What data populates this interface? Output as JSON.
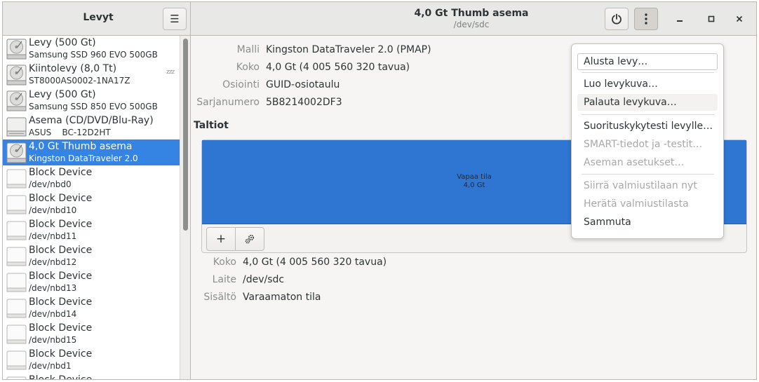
{
  "sidebar": {
    "title": "Levyt",
    "devices": [
      {
        "name": "Levy (500 Gt)",
        "sub": "Samsung SSD 960 EVO 500GB",
        "icon": "hard-disk-icon"
      },
      {
        "name": "Kiintolevy (8,0 Tt)",
        "sub": "ST8000AS0002-1NA17Z",
        "icon": "hard-disk-icon",
        "badge": "zzz"
      },
      {
        "name": "Levy (500 Gt)",
        "sub": "Samsung SSD 850 EVO 500GB",
        "icon": "hard-disk-icon"
      },
      {
        "name": "Asema (CD/DVD/Blu-Ray)",
        "sub": "ASUS    BC-12D2HT",
        "icon": "optical-drive-icon"
      },
      {
        "name": "4,0 Gt Thumb asema",
        "sub": "Kingston DataTraveler 2.0",
        "icon": "hard-disk-icon",
        "selected": true
      },
      {
        "name": "Block Device",
        "sub": "/dev/nbd0",
        "icon": "block-device-icon"
      },
      {
        "name": "Block Device",
        "sub": "/dev/nbd10",
        "icon": "block-device-icon"
      },
      {
        "name": "Block Device",
        "sub": "/dev/nbd11",
        "icon": "block-device-icon"
      },
      {
        "name": "Block Device",
        "sub": "/dev/nbd12",
        "icon": "block-device-icon"
      },
      {
        "name": "Block Device",
        "sub": "/dev/nbd13",
        "icon": "block-device-icon"
      },
      {
        "name": "Block Device",
        "sub": "/dev/nbd14",
        "icon": "block-device-icon"
      },
      {
        "name": "Block Device",
        "sub": "/dev/nbd15",
        "icon": "block-device-icon"
      },
      {
        "name": "Block Device",
        "sub": "/dev/nbd1",
        "icon": "block-device-icon"
      },
      {
        "name": "Block Device",
        "sub": "",
        "icon": "block-device-icon"
      }
    ]
  },
  "header": {
    "title": "4,0 Gt Thumb asema",
    "subtitle": "/dev/sdc"
  },
  "drive_info": [
    {
      "key": "Malli",
      "value": "Kingston DataTraveler 2.0 (PMAP)"
    },
    {
      "key": "Koko",
      "value": "4,0 Gt (4 005 560 320 tavua)"
    },
    {
      "key": "Osiointi",
      "value": "GUID-osiotaulu"
    },
    {
      "key": "Sarjanumero",
      "value": "5B8214002DF3"
    }
  ],
  "volumes": {
    "title": "Taltiot",
    "segment_label": "Vapaa tila",
    "segment_size": "4,0 Gt",
    "add_label": "+"
  },
  "volume_info": [
    {
      "key": "Koko",
      "value": "4,0 Gt (4 005 560 320 tavua)"
    },
    {
      "key": "Laite",
      "value": "/dev/sdc"
    },
    {
      "key": "Sisältö",
      "value": "Varaamaton tila"
    }
  ],
  "menu": {
    "items": [
      {
        "label": "Alusta levy…",
        "enabled": true
      },
      {
        "label": "Luo levykuva…",
        "enabled": true
      },
      {
        "label": "Palauta levykuva…",
        "enabled": true
      },
      {
        "label": "Suorituskykytesti levylle…",
        "enabled": true
      },
      {
        "label": "SMART-tiedot ja -testit…",
        "enabled": false
      },
      {
        "label": "Aseman asetukset…",
        "enabled": false
      },
      {
        "label": "Siirrä valmiustilaan nyt",
        "enabled": false
      },
      {
        "label": "Herätä valmiustilasta",
        "enabled": false
      },
      {
        "label": "Sammuta",
        "enabled": true
      }
    ]
  },
  "colors": {
    "selection": "#3584e4",
    "volume_free": "#2f76d2",
    "header_bg": "#e8e8e7"
  }
}
